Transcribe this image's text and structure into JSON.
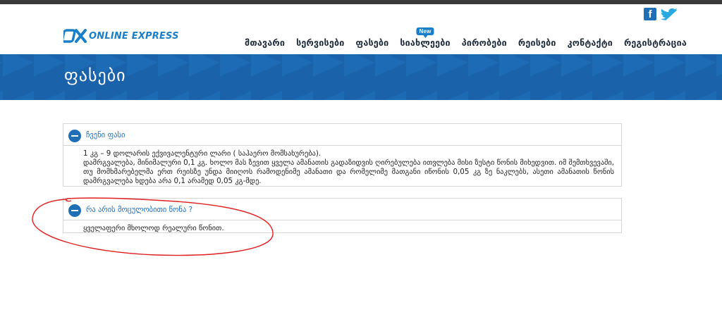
{
  "header": {
    "logo_mark": "OX",
    "logo_text": "ONLINE EXPRESS",
    "social": {
      "facebook_glyph": "f"
    },
    "nav": [
      {
        "label": "მთავარი"
      },
      {
        "label": "სერვისები"
      },
      {
        "label": "ფასები"
      },
      {
        "label": "სიახლეები",
        "badge": "New"
      },
      {
        "label": "პირობები"
      },
      {
        "label": "რეისები"
      },
      {
        "label": "კონტაქტი"
      },
      {
        "label": "რეგისტრაცია"
      }
    ]
  },
  "banner": {
    "title": "ფასები"
  },
  "faq": [
    {
      "title": "ჩვენი ფასი",
      "lines": [
        "1 კგ – 9 დოლარის ექვივალენტური ლარი ( საჰაერო მომსახურება).",
        "დამრგვალება, მინიმალური 0,1 კგ. ხოლო მას ზევით ყველა ამანათის გადაზიდვის ღირებულება ითვლება მისი ზუსტი წონის მიხედვით. იმ შემთხვევაში, თუ მომხმარებელმა ერთ რეისზე უნდა მიიღოს რამოდენიმე ამანათი და რომელიმე მათგანი იწონის 0,05 კგ ზე ნაკლებს, ასეთი ამანათის წონის დამრგვალება ხდება არა 0,1 არამედ 0,05 კგ-მდე."
      ]
    },
    {
      "title": "რა არის მოცულობითი წონა ?",
      "lines": [
        "ყველაფერი მხოლოდ რეალური წონით."
      ]
    }
  ],
  "colors": {
    "brand_blue": "#1a7fc9",
    "banner_blue": "#1a63aa",
    "annotation_red": "#e02020"
  }
}
